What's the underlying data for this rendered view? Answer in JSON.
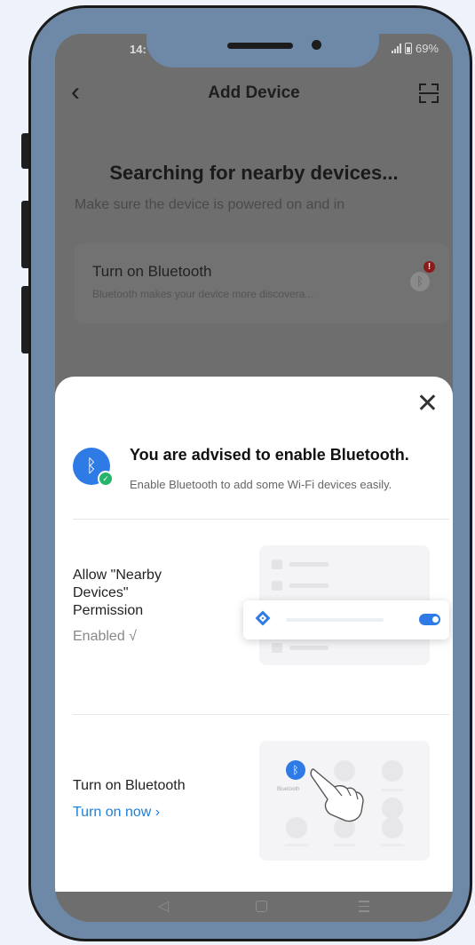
{
  "status_bar": {
    "time": "14:",
    "battery": "69%"
  },
  "header": {
    "back_icon": "chevron-left-icon",
    "title": "Add Device",
    "scan_icon": "scan-icon"
  },
  "search": {
    "title": "Searching for nearby devices...",
    "subtitle": "Make sure the device is powered on and in"
  },
  "bluetooth_card": {
    "title": "Turn on Bluetooth",
    "subtitle": "Bluetooth makes your device more discovera...",
    "alert": "!"
  },
  "sheet": {
    "advise_title": "You are advised to enable Bluetooth.",
    "advise_subtitle": "Enable Bluetooth to add some Wi-Fi devices easily.",
    "permission": {
      "title": "Allow \"Nearby Devices\" Permission",
      "status": "Enabled √"
    },
    "bluetooth": {
      "title": "Turn on Bluetooth",
      "link": "Turn on now ›",
      "illustration_label": "Bluetooth"
    },
    "accent_color": "#2f7be6",
    "success_color": "#27b36a"
  }
}
